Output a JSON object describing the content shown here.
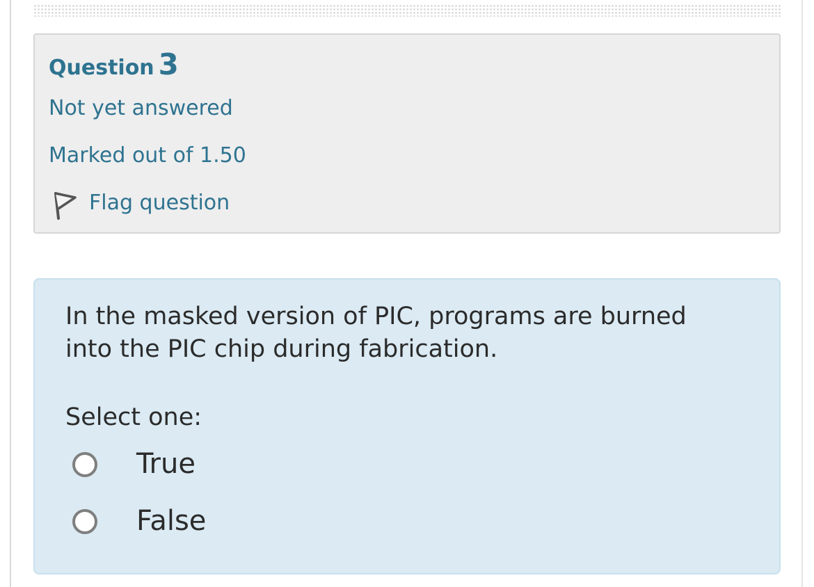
{
  "question_info": {
    "label": "Question",
    "number": "3",
    "state": "Not yet answered",
    "grade": "Marked out of 1.50",
    "flag": {
      "label": "Flag question",
      "icon": "flag-icon"
    }
  },
  "question": {
    "text": "In the masked version of PIC, programs are burned into the PIC chip during fabrication.",
    "prompt": "Select one:",
    "answers": [
      {
        "label": "True",
        "selected": false
      },
      {
        "label": "False",
        "selected": false
      }
    ]
  },
  "colors": {
    "link_blue": "#2e7390",
    "info_bg": "#eeeeee",
    "content_bg": "#dbeaf3"
  }
}
